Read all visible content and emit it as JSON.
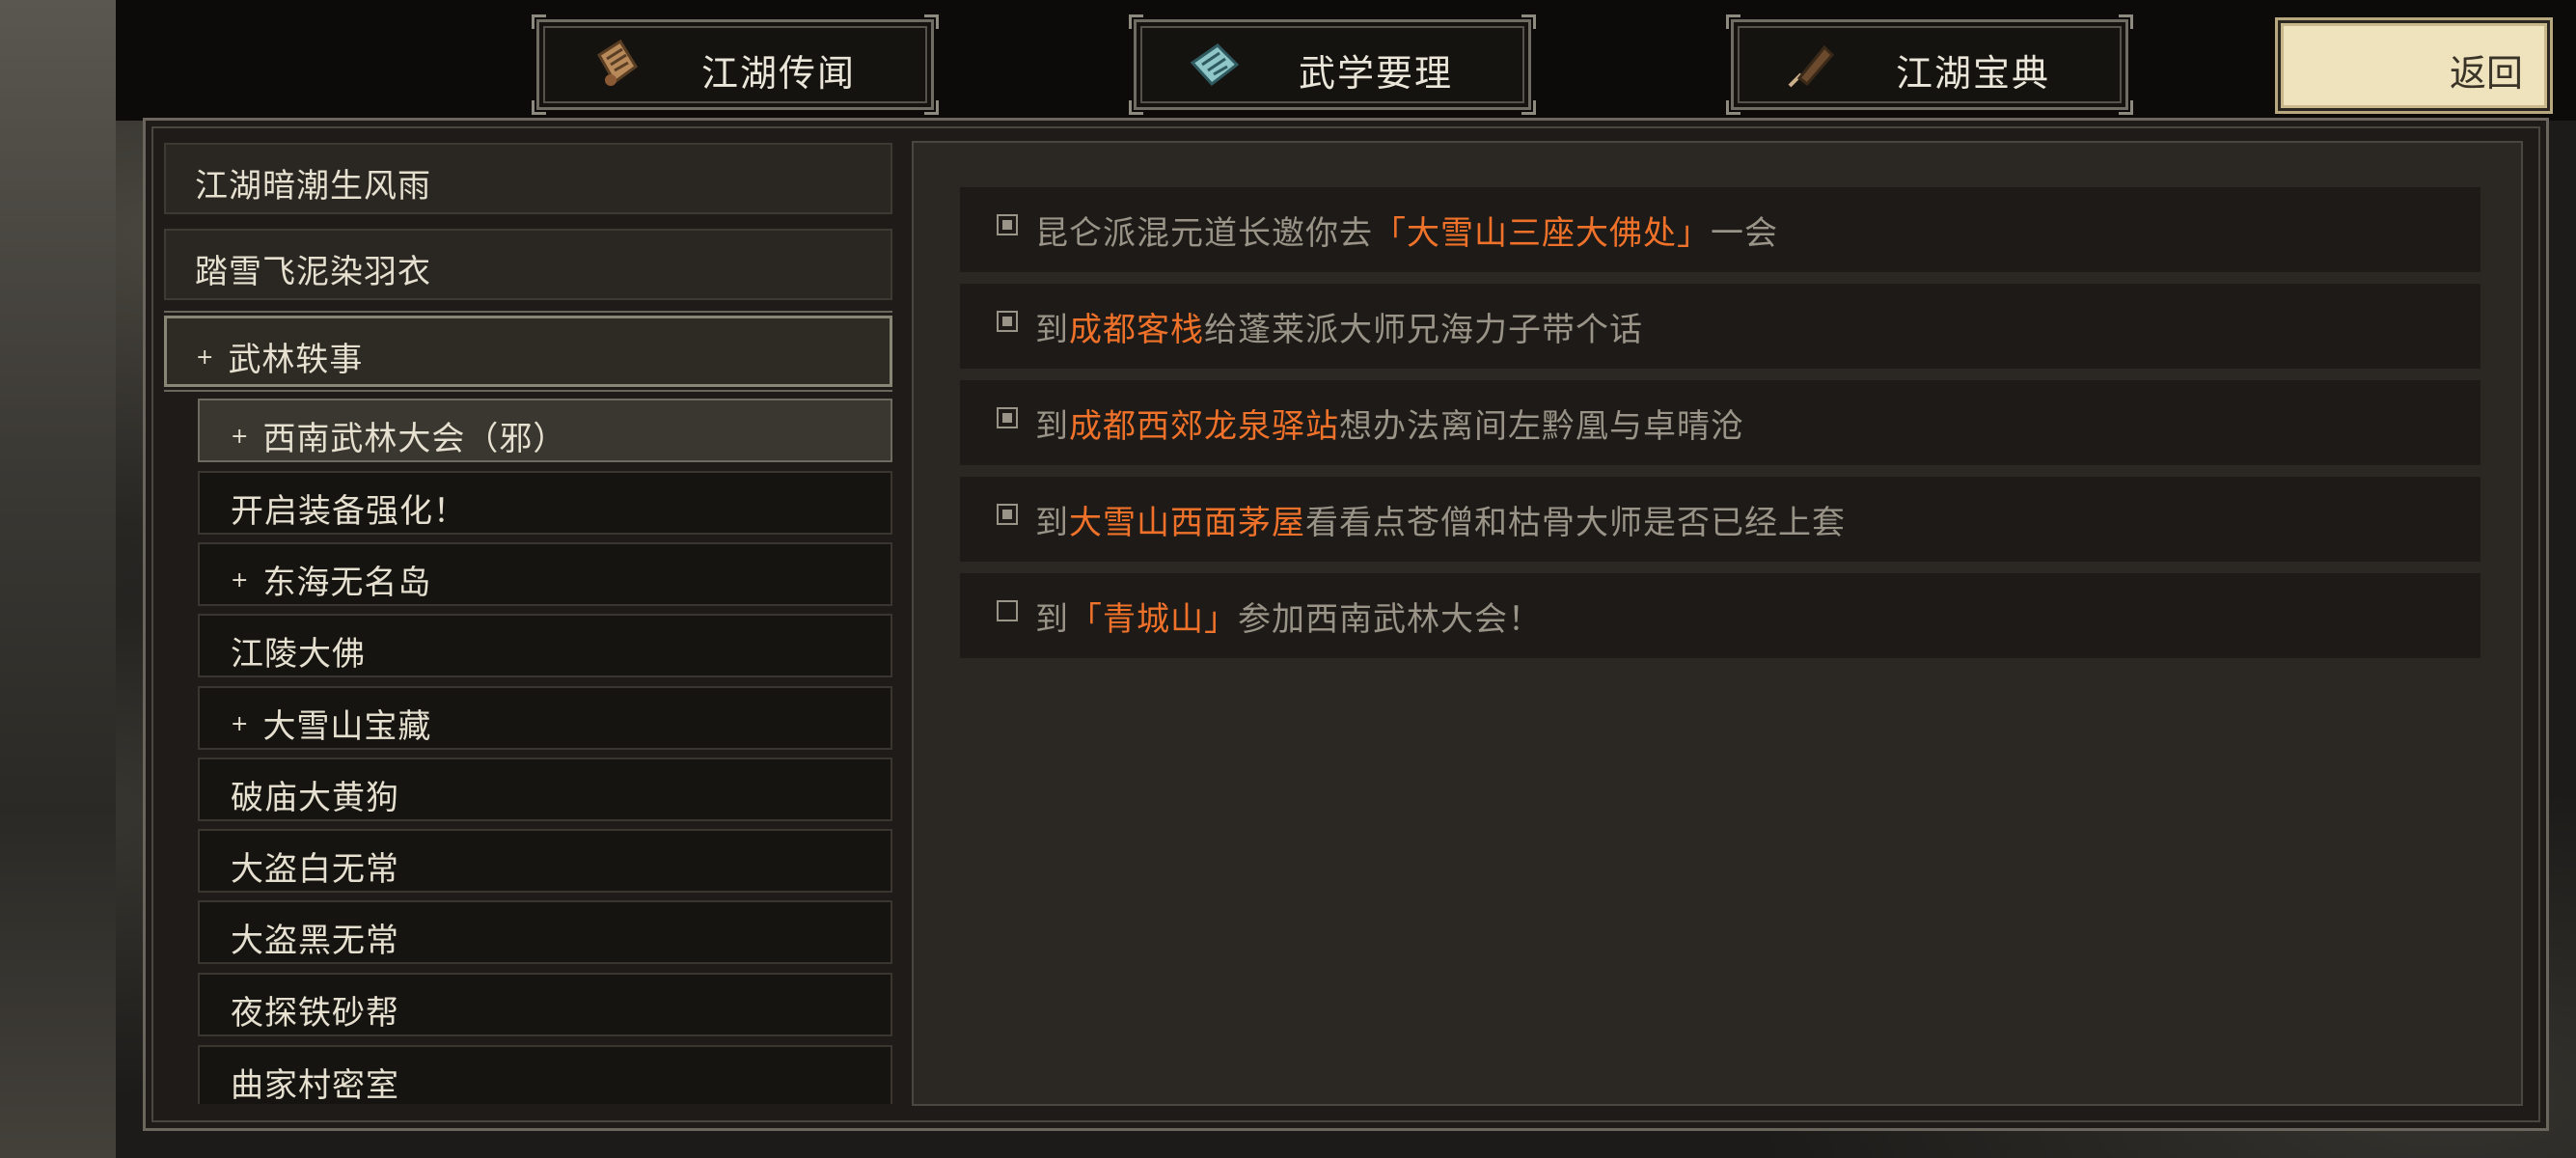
{
  "tabs": [
    {
      "label": "江湖传闻",
      "icon": "scroll-icon"
    },
    {
      "label": "武学要理",
      "icon": "manual-icon"
    },
    {
      "label": "江湖宝典",
      "icon": "brush-icon"
    }
  ],
  "back_label": "返回",
  "left_list": {
    "main_items": [
      "江湖暗潮生风雨",
      "踏雪飞泥染羽衣",
      "武林轶事"
    ],
    "expanded_prefix": "+",
    "sub_items": [
      {
        "label": "西南武林大会（邪）",
        "star": "+"
      },
      {
        "label": "开启装备强化！",
        "star": ""
      },
      {
        "label": "东海无名岛",
        "star": "+"
      },
      {
        "label": "江陵大佛",
        "star": ""
      },
      {
        "label": "大雪山宝藏",
        "star": "+"
      },
      {
        "label": "破庙大黄狗",
        "star": ""
      },
      {
        "label": "大盗白无常",
        "star": ""
      },
      {
        "label": "大盗黑无常",
        "star": ""
      },
      {
        "label": "夜探铁砂帮",
        "star": ""
      },
      {
        "label": "曲家村密室",
        "star": ""
      }
    ]
  },
  "quests": [
    {
      "done": true,
      "pre": "昆仑派混元道长邀你去",
      "hl": "「大雪山三座大佛处」",
      "post": "一会"
    },
    {
      "done": true,
      "pre": "到",
      "hl": "成都客栈",
      "post": "给蓬莱派大师兄海力子带个话"
    },
    {
      "done": true,
      "pre": "到",
      "hl": "成都西郊龙泉驿站",
      "post": "想办法离间左黔凰与卓晴沧"
    },
    {
      "done": true,
      "pre": "到",
      "hl": "大雪山西面茅屋",
      "post": "看看点苍僧和枯骨大师是否已经上套"
    },
    {
      "done": false,
      "pre": "到",
      "hl": "「青城山」",
      "post": "参加西南武林大会！"
    }
  ],
  "colors": {
    "highlight": "#f0722a",
    "back_button": "#efe3be"
  }
}
